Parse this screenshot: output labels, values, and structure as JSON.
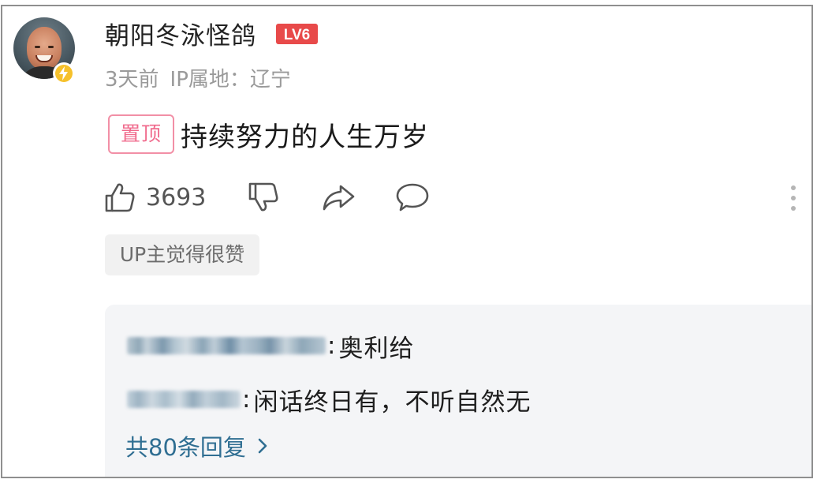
{
  "comment": {
    "username": "朝阳冬泳怪鸽",
    "level": "LV6",
    "time": "3天前",
    "ip_location": "IP属地：辽宁",
    "pinned_label": "置顶",
    "text": "持续努力的人生万岁",
    "likes": "3693",
    "up_badge": "UP主觉得很赞"
  },
  "replies": {
    "items": [
      {
        "user": "[blurred]",
        "separator": ":",
        "text": "奥利给"
      },
      {
        "user": "[blurred]",
        "separator": ":",
        "text": "闲话终日有，不听自然无"
      }
    ],
    "view_all": "共80条回复"
  },
  "icons": {
    "avatar_badge": "lightning-icon",
    "like": "thumbs-up-icon",
    "dislike": "thumbs-down-icon",
    "share": "share-icon",
    "reply": "comment-icon",
    "more": "more-vertical-icon",
    "view_all": "chevron-right-icon"
  },
  "colors": {
    "level_badge": "#e84a4a",
    "pinned": "#f06a8c",
    "link": "#2f6e92",
    "avatar_badge": "#f6c12b"
  }
}
